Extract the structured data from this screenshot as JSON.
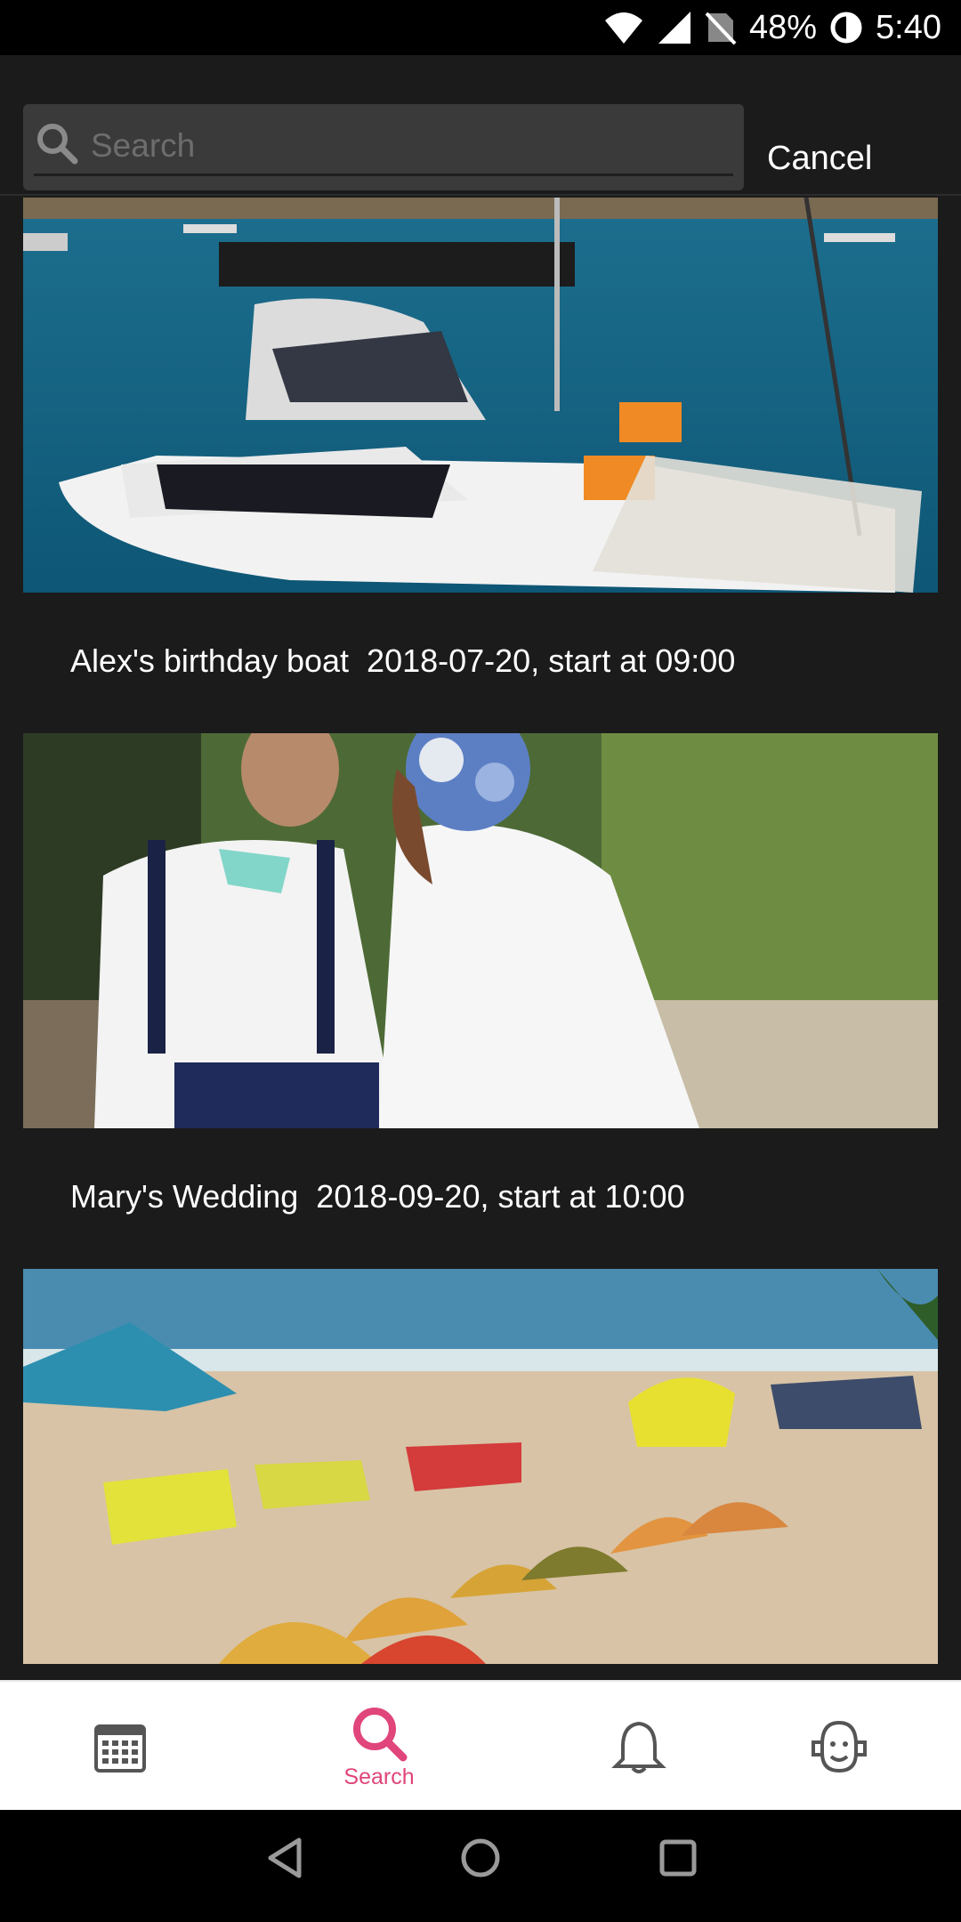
{
  "status_bar": {
    "battery": "48%",
    "time": "5:40",
    "icons": [
      "wifi-icon",
      "signal-icon",
      "no-sim-icon",
      "battery-icon"
    ]
  },
  "search": {
    "placeholder": "Search",
    "value": "",
    "cancel_label": "Cancel"
  },
  "events": [
    {
      "title": "Alex's birthday boat  2018-07-20, start at 09:00",
      "image": "sailboat catamaran at harbor"
    },
    {
      "title": "Mary's Wedding  2018-09-20, start at 10:00",
      "image": "bride and groom outdoors"
    },
    {
      "title": "",
      "image": "beach with colorful tents"
    }
  ],
  "bottom_nav": {
    "items": [
      {
        "icon": "calendar-icon",
        "label": ""
      },
      {
        "icon": "search-icon",
        "label": "Search",
        "active": true
      },
      {
        "icon": "bell-icon",
        "label": ""
      },
      {
        "icon": "profile-icon",
        "label": ""
      }
    ],
    "active_color": "#e0457b"
  },
  "system_nav": [
    "back-icon",
    "home-icon",
    "recents-icon"
  ]
}
